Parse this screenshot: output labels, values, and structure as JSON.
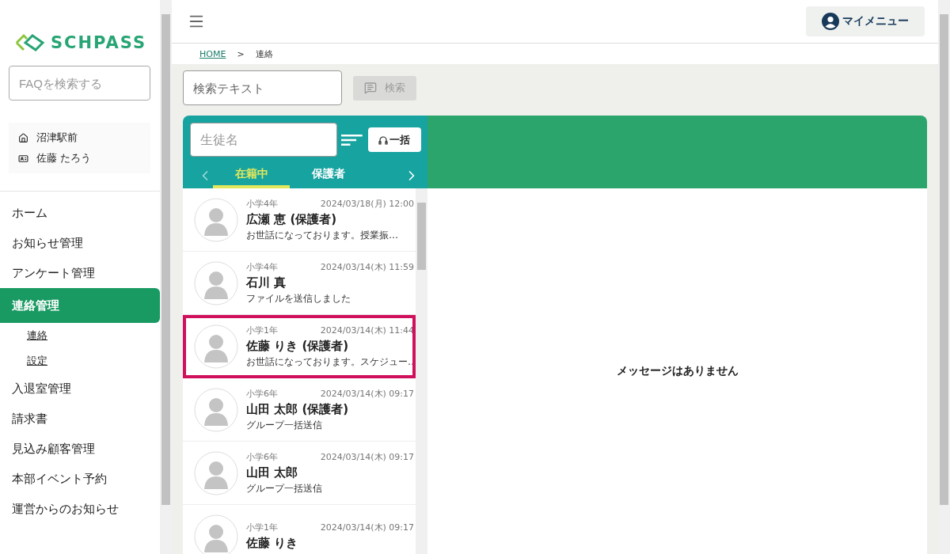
{
  "logo": {
    "text": "SCHPASS"
  },
  "faq_search": {
    "placeholder": "FAQを検索する"
  },
  "account": {
    "school": "沼津駅前",
    "user": "佐藤 たろう"
  },
  "nav": [
    {
      "label": "ホーム",
      "selected": false
    },
    {
      "label": "お知らせ管理",
      "selected": false
    },
    {
      "label": "アンケート管理",
      "selected": false
    },
    {
      "label": "連絡管理",
      "selected": true,
      "children": [
        {
          "label": "連絡"
        },
        {
          "label": "設定"
        }
      ]
    },
    {
      "label": "入退室管理",
      "selected": false
    },
    {
      "label": "請求書",
      "selected": false
    },
    {
      "label": "見込み顧客管理",
      "selected": false
    },
    {
      "label": "本部イベント予約",
      "selected": false
    },
    {
      "label": "運営からのお知らせ",
      "selected": false
    }
  ],
  "header": {
    "my_menu": "マイメニュー"
  },
  "breadcrumb": [
    "HOME",
    "連絡"
  ],
  "breadcrumb_separator": ">",
  "search": {
    "placeholder": "検索テキスト",
    "button": "検索",
    "disabled": true
  },
  "student_filter": {
    "placeholder": "生徒名",
    "bulk_button": "一括"
  },
  "tabs": [
    {
      "label": "在籍中",
      "selected": true
    },
    {
      "label": "保護者",
      "selected": false
    }
  ],
  "conversations": [
    {
      "grade": "小学4年",
      "time": "2024/03/18(月) 12:00",
      "name": "広瀬 恵 (保護者)",
      "preview": "お世話になっております。授業振…",
      "selected": false
    },
    {
      "grade": "小学4年",
      "time": "2024/03/14(木) 11:59",
      "name": "石川 真",
      "preview": "ファイルを送信しました",
      "selected": false
    },
    {
      "grade": "小学1年",
      "time": "2024/03/14(木) 11:44",
      "name": "佐藤 りき (保護者)",
      "preview": "お世話になっております。スケジュー…",
      "selected": true
    },
    {
      "grade": "小学6年",
      "time": "2024/03/14(木) 09:17",
      "name": "山田 太郎 (保護者)",
      "preview": "グループ一括送信",
      "selected": false
    },
    {
      "grade": "小学6年",
      "time": "2024/03/14(木) 09:17",
      "name": "山田 太郎",
      "preview": "グループ一括送信",
      "selected": false
    },
    {
      "grade": "小学1年",
      "time": "2024/03/14(木) 09:17",
      "name": "佐藤 りき",
      "selected": false
    }
  ],
  "empty_message": "メッセージはありません"
}
